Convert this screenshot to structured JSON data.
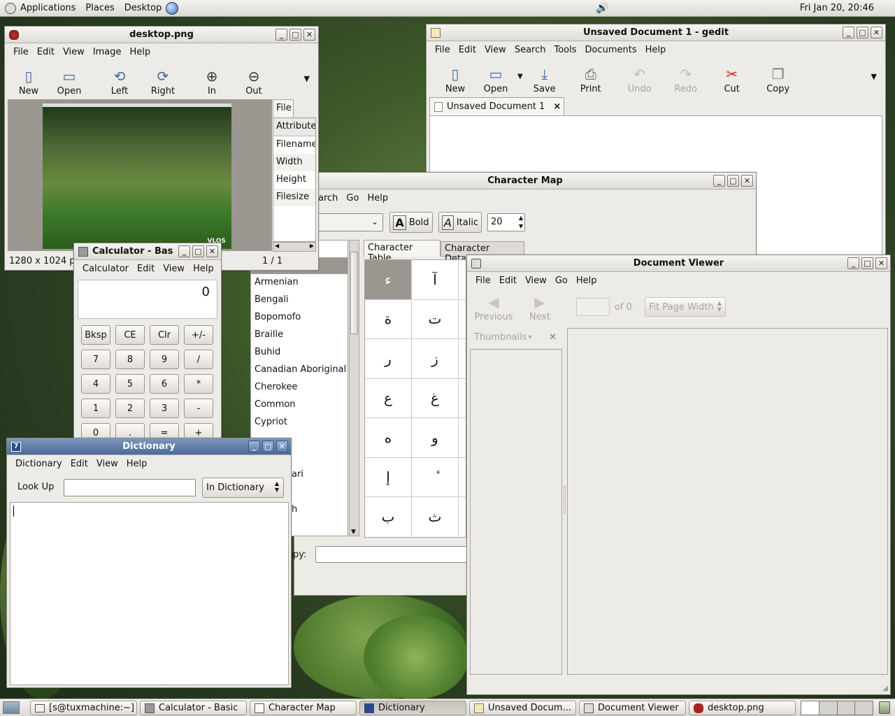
{
  "panel": {
    "applications": "Applications",
    "places": "Places",
    "desktop": "Desktop",
    "clock": "Fri Jan 20, 20:46"
  },
  "eog": {
    "title": "desktop.png",
    "menu": [
      "File",
      "Edit",
      "View",
      "Image",
      "Help"
    ],
    "tools": [
      "New",
      "Open",
      "Left",
      "Right",
      "In",
      "Out"
    ],
    "sidebar_tab": "File",
    "sidebar_header": "Attribute",
    "attributes": [
      "Filename",
      "Width",
      "Height",
      "Filesize"
    ],
    "status_size": "1280 x 1024 p",
    "status_page": "1 / 1",
    "watermark": "VLOS"
  },
  "gedit": {
    "title": "Unsaved Document 1 - gedit",
    "menu": [
      "File",
      "Edit",
      "View",
      "Search",
      "Tools",
      "Documents",
      "Help"
    ],
    "tools": [
      "New",
      "Open",
      "Save",
      "Print",
      "Undo",
      "Redo",
      "Cut",
      "Copy"
    ],
    "tab": "Unsaved Document 1"
  },
  "charmap": {
    "title": "Character Map",
    "menu": [
      "earch",
      "Go",
      "Help"
    ],
    "bold": "Bold",
    "italic": "Italic",
    "size": "20",
    "tabs": [
      "Character Table",
      "Character Details"
    ],
    "scripts": [
      "Armenian",
      "Bengali",
      "Bopomofo",
      "Braille",
      "Buhid",
      "Canadian Aboriginal",
      "Cherokee",
      "Common",
      "Cypriot"
    ],
    "partial": [
      "ari",
      "h"
    ],
    "copy_label": "opy:",
    "chars": [
      "ء",
      "آ",
      "ة",
      "ت",
      "ر",
      "ز",
      "ع",
      "غ",
      "ه",
      "و",
      "إ",
      "ٔ",
      "ب",
      "ث"
    ]
  },
  "calc": {
    "title": "Calculator - Bas",
    "menu": [
      "Calculator",
      "Edit",
      "View",
      "Help"
    ],
    "display": "0",
    "keys": [
      "Bksp",
      "CE",
      "Clr",
      "+/-",
      "7",
      "8",
      "9",
      "/",
      "4",
      "5",
      "6",
      "*",
      "1",
      "2",
      "3",
      "-",
      "0",
      ".",
      "=",
      "+"
    ]
  },
  "dict": {
    "title": "Dictionary",
    "menu": [
      "Dictionary",
      "Edit",
      "View",
      "Help"
    ],
    "lookup": "Look Up",
    "source": "In Dictionary"
  },
  "evince": {
    "title": "Document Viewer",
    "menu": [
      "File",
      "Edit",
      "View",
      "Go",
      "Help"
    ],
    "previous": "Previous",
    "next": "Next",
    "of": "of 0",
    "zoom": "Fit Page Width",
    "thumbnails": "Thumbnails"
  },
  "taskbar": [
    "[s@tuxmachine:~]",
    "Calculator - Basic",
    "Character Map",
    "Dictionary",
    "Unsaved Docum...",
    "Document Viewer",
    "desktop.png"
  ]
}
